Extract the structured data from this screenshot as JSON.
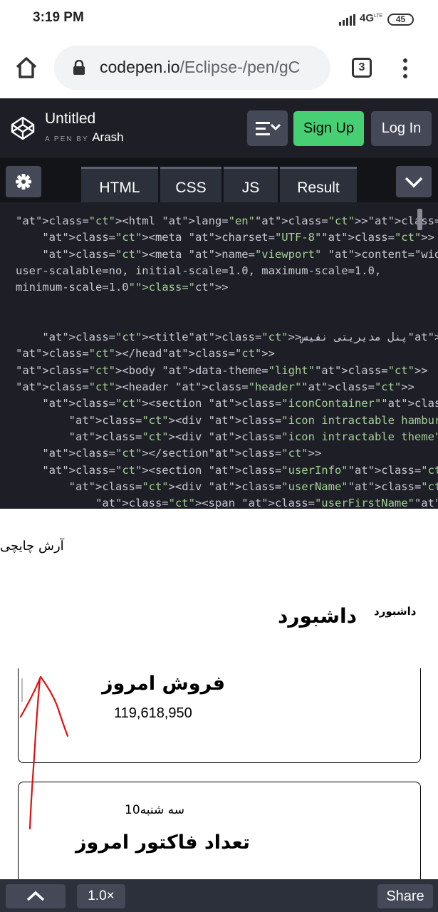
{
  "status_bar": {
    "time": "3:19 PM",
    "network": "4G",
    "network_sub": "LTE",
    "battery": "45"
  },
  "browser": {
    "url_host": "codepen.io",
    "url_path": "/Eclipse-/pen/gC",
    "tab_count": "3"
  },
  "codepen": {
    "title": "Untitled",
    "byline_prefix": "A PEN BY",
    "author": "Arash",
    "signup_label": "Sign Up",
    "login_label": "Log In",
    "tabs": [
      {
        "label": "HTML"
      },
      {
        "label": "CSS"
      },
      {
        "label": "JS"
      },
      {
        "label": "Result"
      }
    ]
  },
  "code_lines": [
    "<html lang=\"en\"><head>",
    "    <meta charset=\"UTF-8\">",
    "    <meta name=\"viewport\" content=\"width=device-width,",
    "user-scalable=no, initial-scale=1.0, maximum-scale=1.0,",
    "minimum-scale=1.0\">",
    "",
    "",
    "    <title>پنل مدیریتی نفیس</title>",
    "</head>",
    "<body data-theme=\"light\">",
    "<header class=\"header\">",
    "    <section class=\"iconContainer\">",
    "        <div class=\"icon intractable hamburger\"></div>",
    "        <div class=\"icon intractable theme\"></div>",
    "    </section>",
    "    <section class=\"userInfo\">",
    "        <div class=\"userName\">",
    "            <span class=\"userFirstName\">آرش</span>"
  ],
  "result": {
    "user_name": "آرش چایچی",
    "breadcrumb": "داشبورد",
    "page_title": "داشبورد",
    "card_sales": {
      "title": "فروش امروز",
      "value": "119,618,950"
    },
    "card_invoices": {
      "date": "سه شنبه10",
      "title": "تعداد فاکتور امروز"
    }
  },
  "bottom_bar": {
    "zoom": "1.0×",
    "share_label": "Share"
  },
  "colors": {
    "signup": "#47cf73",
    "header_bg": "#1e1f26",
    "button_bg": "#444857",
    "annotation": "#e01010"
  }
}
